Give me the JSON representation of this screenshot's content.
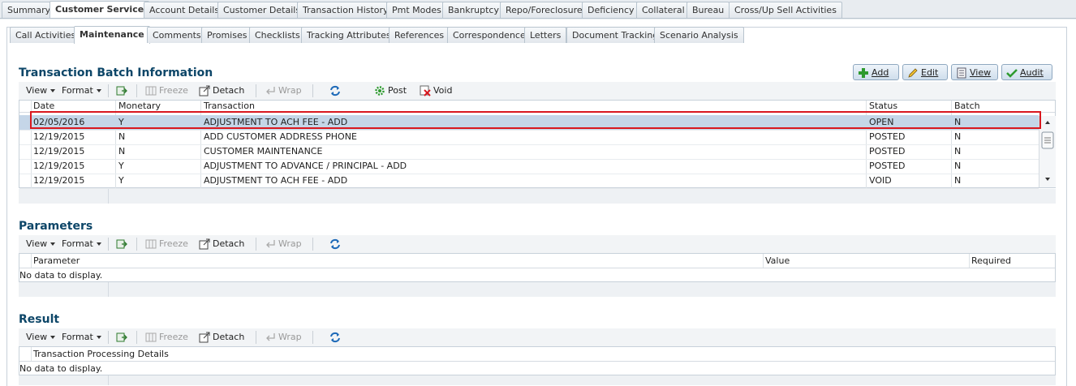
{
  "top_tabs": [
    "Summary",
    "Customer Service",
    "Account Details",
    "Customer Details",
    "Transaction History",
    "Pmt Modes",
    "Bankruptcy",
    "Repo/Foreclosure",
    "Deficiency",
    "Collateral",
    "Bureau",
    "Cross/Up Sell Activities"
  ],
  "sub_tabs": [
    "Call Activities",
    "Maintenance",
    "Comments",
    "Promises",
    "Checklists",
    "Tracking Attributes",
    "References",
    "Correspondence",
    "Letters",
    "Document Tracking",
    "Scenario Analysis"
  ],
  "toolbar": {
    "view": "View",
    "format": "Format",
    "freeze": "Freeze",
    "detach": "Detach",
    "wrap": "Wrap",
    "post": "Post",
    "void": "Void"
  },
  "buttons": {
    "add": "Add",
    "edit": "Edit",
    "view": "View",
    "audit": "Audit"
  },
  "batch": {
    "title": "Transaction Batch Information",
    "headers": {
      "date": "Date",
      "monetary": "Monetary",
      "transaction": "Transaction",
      "status": "Status",
      "batch": "Batch"
    },
    "rows": [
      {
        "date": "02/05/2016",
        "monetary": "Y",
        "transaction": "ADJUSTMENT TO ACH FEE - ADD",
        "status": "OPEN",
        "batch": "N"
      },
      {
        "date": "12/19/2015",
        "monetary": "N",
        "transaction": "ADD CUSTOMER ADDRESS PHONE",
        "status": "POSTED",
        "batch": "N"
      },
      {
        "date": "12/19/2015",
        "monetary": "N",
        "transaction": "CUSTOMER MAINTENANCE",
        "status": "POSTED",
        "batch": "N"
      },
      {
        "date": "12/19/2015",
        "monetary": "Y",
        "transaction": "ADJUSTMENT TO ADVANCE / PRINCIPAL - ADD",
        "status": "POSTED",
        "batch": "N"
      },
      {
        "date": "12/19/2015",
        "monetary": "Y",
        "transaction": "ADJUSTMENT TO ACH FEE - ADD",
        "status": "VOID",
        "batch": "N"
      }
    ]
  },
  "parameters": {
    "title": "Parameters",
    "headers": {
      "parameter": "Parameter",
      "value": "Value",
      "required": "Required"
    },
    "empty": "No data to display."
  },
  "result": {
    "title": "Result",
    "headers": {
      "details": "Transaction Processing Details"
    },
    "empty": "No data to display."
  }
}
